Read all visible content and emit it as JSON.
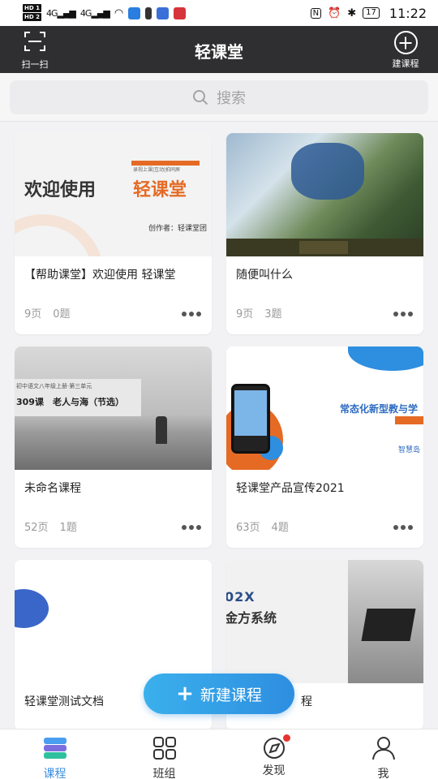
{
  "status_bar": {
    "hd1": "HD 1",
    "hd2": "HD 2",
    "signal1": "4G",
    "signal2": "4G",
    "nfc": "N",
    "battery": "17",
    "time": "11:22"
  },
  "header": {
    "scan_label": "扫一扫",
    "title": "轻课堂",
    "create_label": "建课程"
  },
  "search": {
    "placeholder": "搜索"
  },
  "courses": [
    {
      "title": "【帮助课堂】欢迎使用 轻课堂",
      "pages": "9页",
      "questions": "0题",
      "thumb_text": {
        "welcome": "欢迎使用",
        "brand": "轻课堂",
        "tagline": "录视上课|互动|拍同屏",
        "author": "创作者：轻课堂团"
      }
    },
    {
      "title": "随便叫什么",
      "pages": "9页",
      "questions": "3题"
    },
    {
      "title": "未命名课程",
      "pages": "52页",
      "questions": "1题",
      "thumb_text": {
        "caption_top": "初中语文八年级上册·第三单元",
        "caption_main": "309课　老人与海（节选）"
      }
    },
    {
      "title": "轻课堂产品宣传2021",
      "pages": "63页",
      "questions": "4题",
      "thumb_text": {
        "headline": "常态化新型教与学",
        "sub": "智慧岛"
      }
    },
    {
      "title": "轻课堂测试文档"
    },
    {
      "title": "程",
      "thumb_text": {
        "line1": "02X",
        "line2": "金方系统"
      }
    }
  ],
  "fab": {
    "label": "新建课程",
    "icon": "plus-icon"
  },
  "tabs": [
    {
      "label": "课程",
      "icon": "course-stack-icon",
      "active": true
    },
    {
      "label": "班组",
      "icon": "grid-icon",
      "active": false
    },
    {
      "label": "发现",
      "icon": "compass-icon",
      "active": false,
      "badge": true
    },
    {
      "label": "我",
      "icon": "person-icon",
      "active": false
    }
  ],
  "colors": {
    "accent": "#3a8de0",
    "header_bg": "#2f2f31",
    "badge": "#e5342f"
  }
}
